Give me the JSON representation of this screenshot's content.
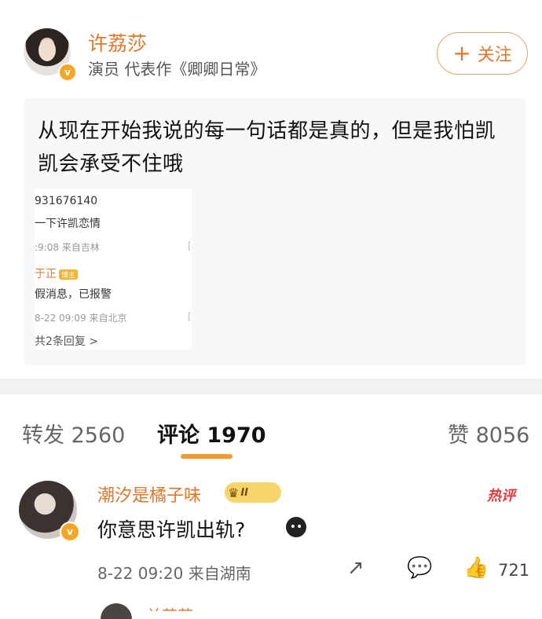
{
  "post": {
    "author": "许荔莎",
    "description": "演员 代表作《卿卿日常》",
    "follow_label": "关注",
    "text": "从现在开始我说的每一句话都是真的，但是我怕凯凯会承受不住哦",
    "embedded_screenshot": {
      "line1": "931676140",
      "line2": "一下许凯恋情",
      "line3": ":9:08  来自吉林",
      "user": "于正",
      "badge": "博主",
      "reply_text": "假消息，已报警",
      "reply_meta": "8-22 09:09  来自北京",
      "more_replies": "共2条回复 >"
    }
  },
  "tabs": {
    "repost": "转发 2560",
    "comments": "评论 1970",
    "likes": "赞 8056"
  },
  "comment": {
    "username": "潮汐是橘子味",
    "level_badge": "II",
    "hot_tag": "热评",
    "text": "你意思许凯出轨?",
    "meta": "8-22 09:20  来自湖南",
    "like_count": "721"
  },
  "next_comment": {
    "username_partial": "兰若若"
  },
  "colors": {
    "accent": "#e2762a",
    "tab_underline": "#f29a2e",
    "hot": "#e4393c"
  }
}
